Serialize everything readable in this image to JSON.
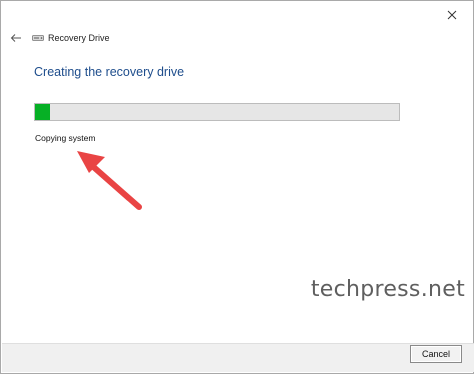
{
  "window": {
    "title": "Recovery Drive",
    "close_icon": "close-icon",
    "back_icon": "back-arrow-icon",
    "drive_icon": "drive-icon"
  },
  "main": {
    "heading": "Creating the recovery drive",
    "progress_percent": 4,
    "status": "Copying system"
  },
  "annotation": {
    "arrow_color": "#e94444",
    "watermark": "techpress.net"
  },
  "footer": {
    "cancel_label": "Cancel"
  },
  "colors": {
    "heading": "#1e4d8c",
    "progress": "#06b025"
  }
}
